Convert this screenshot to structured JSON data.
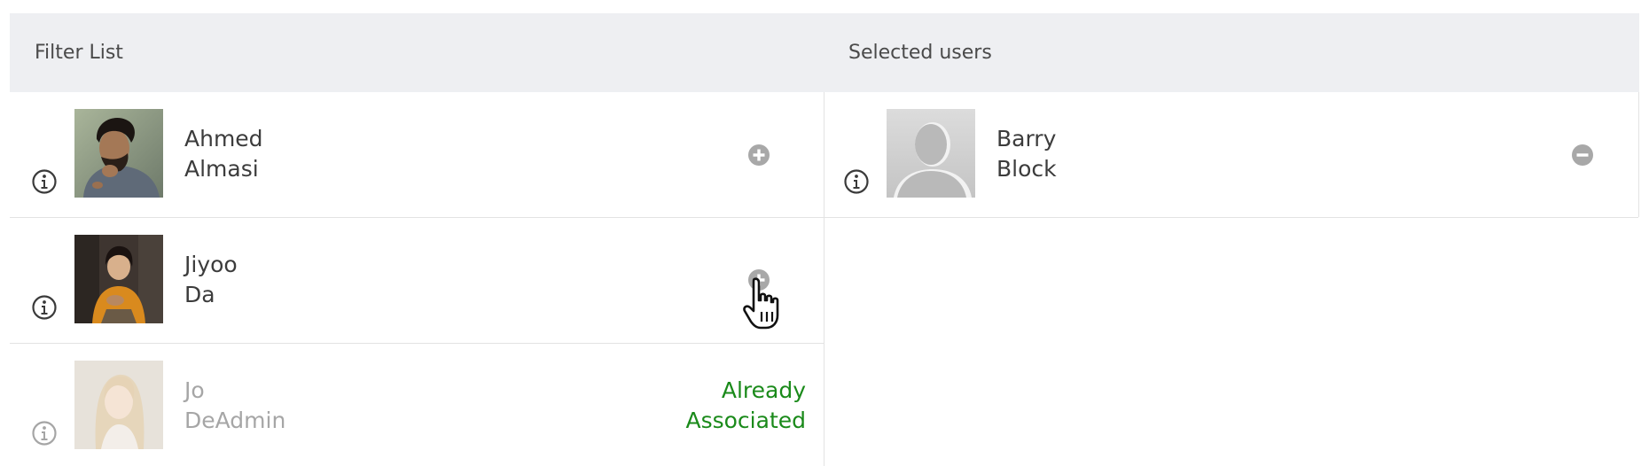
{
  "filter_list": {
    "header": "Filter List",
    "users": [
      {
        "first": "Ahmed",
        "last": "Almasi",
        "action": "add",
        "avatar": "photo-man-curly-hair"
      },
      {
        "first": "Jiyoo",
        "last": "Da",
        "action": "add",
        "avatar": "photo-woman-orange-top"
      },
      {
        "first": "Jo",
        "last": "DeAdmin",
        "action": "none",
        "status_line1": "Already",
        "status_line2": "Associated",
        "avatar": "photo-woman-blonde"
      }
    ]
  },
  "selected_users": {
    "header": "Selected users",
    "users": [
      {
        "first": "Barry",
        "last": "Block",
        "action": "remove",
        "avatar": "placeholder-silhouette"
      }
    ]
  },
  "colors": {
    "header_bg": "#eeeff2",
    "divider": "#e3e3e3",
    "status_green": "#1a8a1a",
    "icon_grey": "#a8a8a8"
  }
}
